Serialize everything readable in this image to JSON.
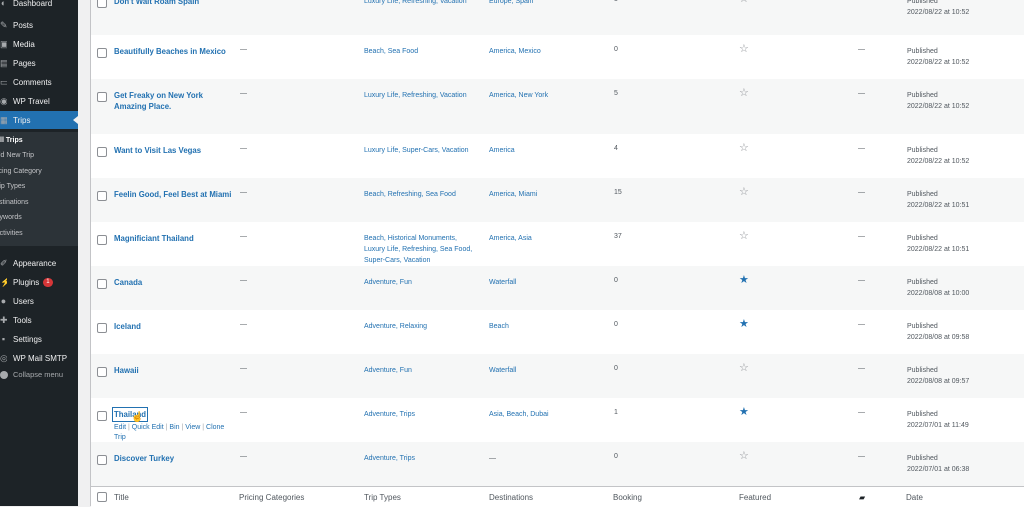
{
  "sidebar": {
    "menu": [
      {
        "label": "Dashboard",
        "icon": "dashboard-icon"
      },
      {
        "label": "Posts",
        "icon": "pin-icon"
      },
      {
        "label": "Media",
        "icon": "media-icon"
      },
      {
        "label": "Pages",
        "icon": "page-icon"
      },
      {
        "label": "Comments",
        "icon": "comment-icon"
      },
      {
        "label": "WP Travel",
        "icon": "travel-icon"
      },
      {
        "label": "Trips",
        "icon": "trips-icon",
        "active": true
      }
    ],
    "submenu": [
      "All Trips",
      "Add New Trip",
      "Pricing Category",
      "Trip Types",
      "Destinations",
      "Keywords",
      "Activities"
    ],
    "menu2": [
      {
        "label": "Appearance",
        "icon": "brush-icon"
      },
      {
        "label": "Plugins",
        "icon": "plug-icon",
        "badge": "1"
      },
      {
        "label": "Users",
        "icon": "user-icon"
      },
      {
        "label": "Tools",
        "icon": "wrench-icon"
      },
      {
        "label": "Settings",
        "icon": "settings-icon"
      },
      {
        "label": "WP Mail SMTP",
        "icon": "mail-icon"
      }
    ],
    "collapse": "Collapse menu"
  },
  "rows": [
    {
      "title": "Don't Wait Roam Spain",
      "pricing": "—",
      "types": [
        "Luxury Life, Refreshing, Vacation"
      ],
      "dest": "Europe, Spain",
      "booking": "5",
      "featured": false,
      "comments": "—",
      "status": "Published",
      "date": "2022/08/22 at 10:52"
    },
    {
      "title": "Beautifully Beaches in Mexico",
      "pricing": "—",
      "types": [
        "Beach, Sea Food"
      ],
      "dest": "America, Mexico",
      "booking": "0",
      "featured": false,
      "comments": "—",
      "status": "Published",
      "date": "2022/08/22 at 10:52"
    },
    {
      "title": [
        "Get Freaky on New York",
        "Amazing Place."
      ],
      "pricing": "—",
      "types": [
        "Luxury Life, Refreshing, Vacation"
      ],
      "dest": "America, New York",
      "booking": "5",
      "featured": false,
      "comments": "—",
      "status": "Published",
      "date": "2022/08/22 at 10:52"
    },
    {
      "title": "Want to Visit Las Vegas",
      "pricing": "—",
      "types": [
        "Luxury Life, Super-Cars, Vacation"
      ],
      "dest": "America",
      "booking": "4",
      "featured": false,
      "comments": "—",
      "status": "Published",
      "date": "2022/08/22 at 10:52"
    },
    {
      "title": "Feelin Good, Feel Best at Miami",
      "pricing": "—",
      "types": [
        "Beach, Refreshing, Sea Food"
      ],
      "dest": "America, Miami",
      "booking": "15",
      "featured": false,
      "comments": "—",
      "status": "Published",
      "date": "2022/08/22 at 10:51"
    },
    {
      "title": "Magnificiant Thailand",
      "pricing": "—",
      "types": [
        "Beach, Historical Monuments,",
        "Luxury Life, Refreshing, Sea Food,",
        "Super-Cars, Vacation"
      ],
      "dest": "America, Asia",
      "booking": "37",
      "featured": false,
      "comments": "—",
      "status": "Published",
      "date": "2022/08/22 at 10:51"
    },
    {
      "title": "Canada",
      "pricing": "—",
      "types": [
        "Adventure, Fun"
      ],
      "dest": "Waterfall",
      "booking": "0",
      "featured": true,
      "comments": "—",
      "status": "Published",
      "date": "2022/08/08 at 10:00"
    },
    {
      "title": "Iceland",
      "pricing": "—",
      "types": [
        "Adventure, Relaxing"
      ],
      "dest": "Beach",
      "booking": "0",
      "featured": true,
      "comments": "—",
      "status": "Published",
      "date": "2022/08/08 at 09:58"
    },
    {
      "title": "Hawaii",
      "pricing": "—",
      "types": [
        "Adventure, Fun"
      ],
      "dest": "Waterfall",
      "booking": "0",
      "featured": false,
      "comments": "—",
      "status": "Published",
      "date": "2022/08/08 at 09:57"
    },
    {
      "title": "Thailand",
      "pricing": "—",
      "types": [
        "Adventure, Trips"
      ],
      "dest": "Asia, Beach, Dubai",
      "booking": "1",
      "featured": true,
      "comments": "—",
      "status": "Published",
      "date": "2022/07/01 at 11:49",
      "actions": [
        "Edit",
        "Quick Edit",
        "Bin",
        "View",
        "Clone"
      ],
      "actions2": "Trip"
    },
    {
      "title": "Discover Turkey",
      "pricing": "—",
      "types": [
        "Adventure, Trips"
      ],
      "dest": "—",
      "booking": "0",
      "featured": false,
      "comments": "—",
      "status": "Published",
      "date": "2022/07/01 at 06:38"
    }
  ],
  "columns": [
    "Title",
    "Pricing Categories",
    "Trip Types",
    "Destinations",
    "Booking",
    "Featured",
    "",
    "Date"
  ],
  "icons": {
    "featured_on": "star-filled-icon",
    "featured_off": "star-outline-icon",
    "comments": "comment-bubble-icon"
  }
}
